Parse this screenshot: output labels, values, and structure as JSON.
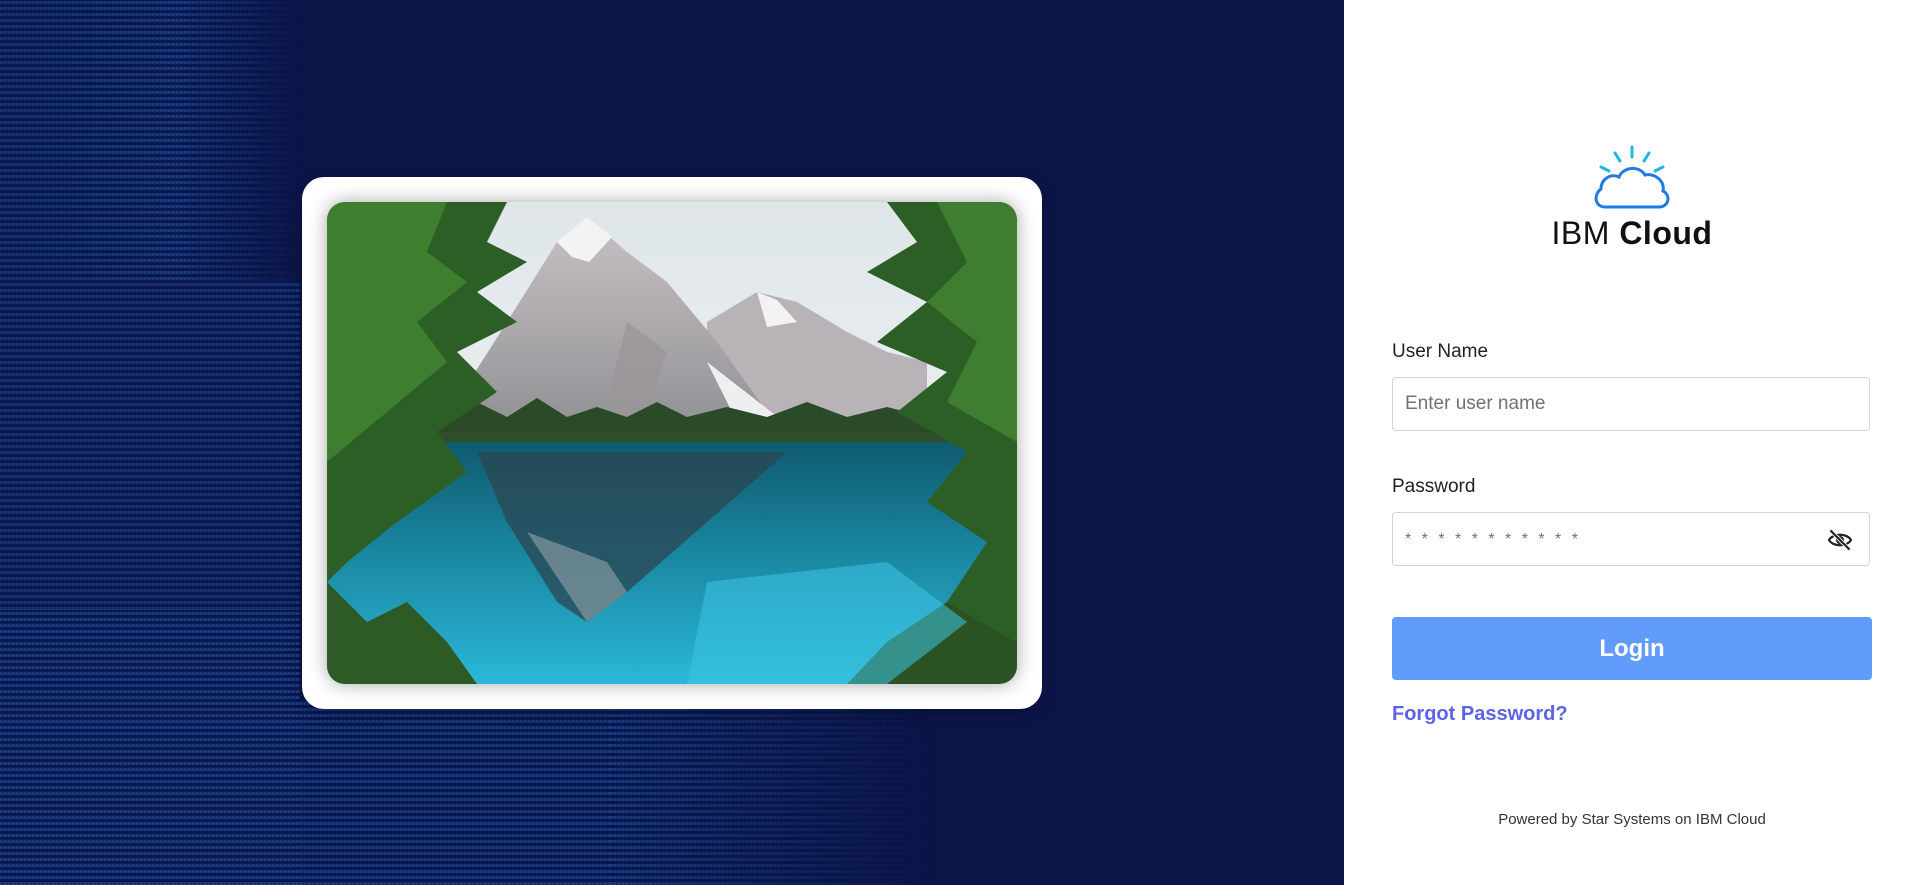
{
  "brand": {
    "prefix": "IBM",
    "name": "Cloud",
    "icon": "cloud-sun-icon",
    "accent": "#1fb6e6"
  },
  "form": {
    "username_label": "User Name",
    "username_placeholder": "Enter user name",
    "password_label": "Password",
    "password_placeholder": "* * * * * * * * * * *",
    "password_toggle_icon": "eye-slash-icon",
    "login_label": "Login",
    "forgot_label": "Forgot Password?"
  },
  "footer": {
    "text": "Powered by Star Systems on IBM Cloud"
  },
  "colors": {
    "left_background": "#0b1548",
    "login_button": "#619bfb",
    "forgot_link": "#5b63e8"
  },
  "hero_image": {
    "icon": "mountain-lake-photo"
  }
}
